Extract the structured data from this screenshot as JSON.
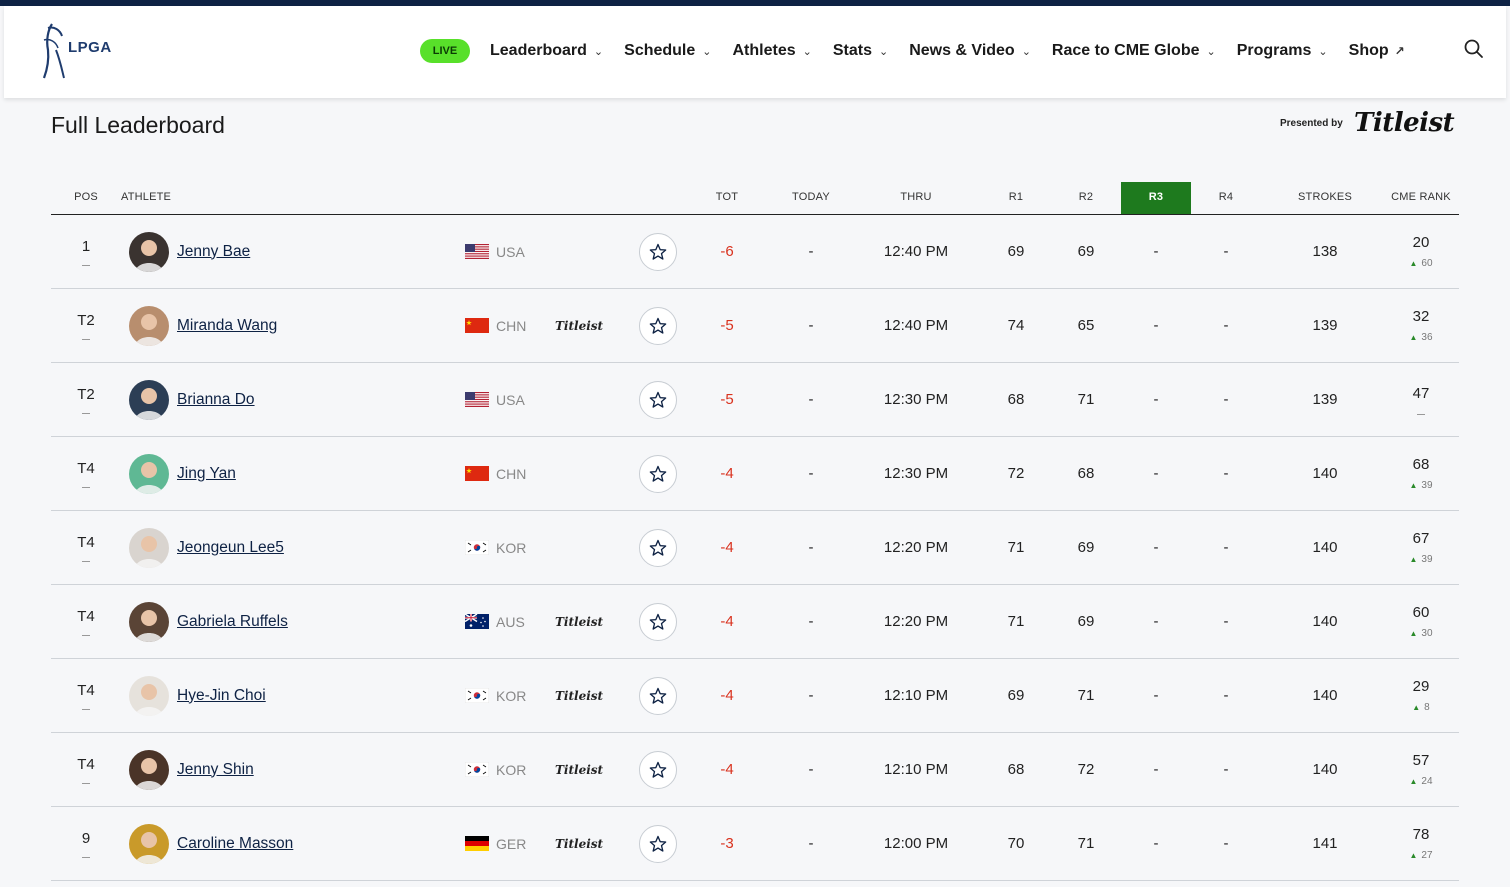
{
  "nav": {
    "brand": "LPGA",
    "live": "LIVE",
    "items": [
      {
        "label": "Leaderboard",
        "chevron": true
      },
      {
        "label": "Schedule",
        "chevron": true
      },
      {
        "label": "Athletes",
        "chevron": true
      },
      {
        "label": "Stats",
        "chevron": true
      },
      {
        "label": "News & Video",
        "chevron": true
      },
      {
        "label": "Race to CME Globe",
        "chevron": true
      },
      {
        "label": "Programs",
        "chevron": true
      },
      {
        "label": "Shop",
        "external": true
      }
    ]
  },
  "page": {
    "title": "Full Leaderboard",
    "presented_by": "Presented by",
    "sponsor": "Titleist"
  },
  "table": {
    "headers": {
      "pos": "POS",
      "athlete": "ATHLETE",
      "tot": "TOT",
      "today": "TODAY",
      "thru": "THRU",
      "r1": "R1",
      "r2": "R2",
      "r3": "R3",
      "r4": "R4",
      "strokes": "STROKES",
      "cme": "CME RANK"
    },
    "active_round_color": "#1e7a1e",
    "rows": [
      {
        "pos": "1",
        "name": "Jenny Bae",
        "country": "USA",
        "flag": "usa",
        "sponsor": "",
        "tot": "-6",
        "today": "-",
        "thru": "12:40 PM",
        "r1": "69",
        "r2": "69",
        "r3": "-",
        "r4": "-",
        "strokes": "138",
        "cme": "20",
        "cme_move": "60",
        "avatar_color": "#3a3330"
      },
      {
        "pos": "T2",
        "name": "Miranda Wang",
        "country": "CHN",
        "flag": "chn",
        "sponsor": "Titleist",
        "tot": "-5",
        "today": "-",
        "thru": "12:40 PM",
        "r1": "74",
        "r2": "65",
        "r3": "-",
        "r4": "-",
        "strokes": "139",
        "cme": "32",
        "cme_move": "36",
        "avatar_color": "#b88e6e"
      },
      {
        "pos": "T2",
        "name": "Brianna Do",
        "country": "USA",
        "flag": "usa",
        "sponsor": "",
        "tot": "-5",
        "today": "-",
        "thru": "12:30 PM",
        "r1": "68",
        "r2": "71",
        "r3": "-",
        "r4": "-",
        "strokes": "139",
        "cme": "47",
        "cme_move": "",
        "avatar_color": "#2c3e55"
      },
      {
        "pos": "T4",
        "name": "Jing Yan",
        "country": "CHN",
        "flag": "chn",
        "sponsor": "",
        "tot": "-4",
        "today": "-",
        "thru": "12:30 PM",
        "r1": "72",
        "r2": "68",
        "r3": "-",
        "r4": "-",
        "strokes": "140",
        "cme": "68",
        "cme_move": "39",
        "avatar_color": "#5fb894"
      },
      {
        "pos": "T4",
        "name": "Jeongeun Lee5",
        "country": "KOR",
        "flag": "kor",
        "sponsor": "",
        "tot": "-4",
        "today": "-",
        "thru": "12:20 PM",
        "r1": "71",
        "r2": "69",
        "r3": "-",
        "r4": "-",
        "strokes": "140",
        "cme": "67",
        "cme_move": "39",
        "avatar_color": "#d9d4cf"
      },
      {
        "pos": "T4",
        "name": "Gabriela Ruffels",
        "country": "AUS",
        "flag": "aus",
        "sponsor": "Titleist",
        "tot": "-4",
        "today": "-",
        "thru": "12:20 PM",
        "r1": "71",
        "r2": "69",
        "r3": "-",
        "r4": "-",
        "strokes": "140",
        "cme": "60",
        "cme_move": "30",
        "avatar_color": "#5a4436"
      },
      {
        "pos": "T4",
        "name": "Hye-Jin Choi",
        "country": "KOR",
        "flag": "kor",
        "sponsor": "Titleist",
        "tot": "-4",
        "today": "-",
        "thru": "12:10 PM",
        "r1": "69",
        "r2": "71",
        "r3": "-",
        "r4": "-",
        "strokes": "140",
        "cme": "29",
        "cme_move": "8",
        "avatar_color": "#e6e2dc"
      },
      {
        "pos": "T4",
        "name": "Jenny Shin",
        "country": "KOR",
        "flag": "kor",
        "sponsor": "Titleist",
        "tot": "-4",
        "today": "-",
        "thru": "12:10 PM",
        "r1": "68",
        "r2": "72",
        "r3": "-",
        "r4": "-",
        "strokes": "140",
        "cme": "57",
        "cme_move": "24",
        "avatar_color": "#4a3428"
      },
      {
        "pos": "9",
        "name": "Caroline Masson",
        "country": "GER",
        "flag": "ger",
        "sponsor": "Titleist",
        "tot": "-3",
        "today": "-",
        "thru": "12:00 PM",
        "r1": "70",
        "r2": "71",
        "r3": "-",
        "r4": "-",
        "strokes": "141",
        "cme": "78",
        "cme_move": "27",
        "avatar_color": "#c99a2a"
      }
    ]
  }
}
